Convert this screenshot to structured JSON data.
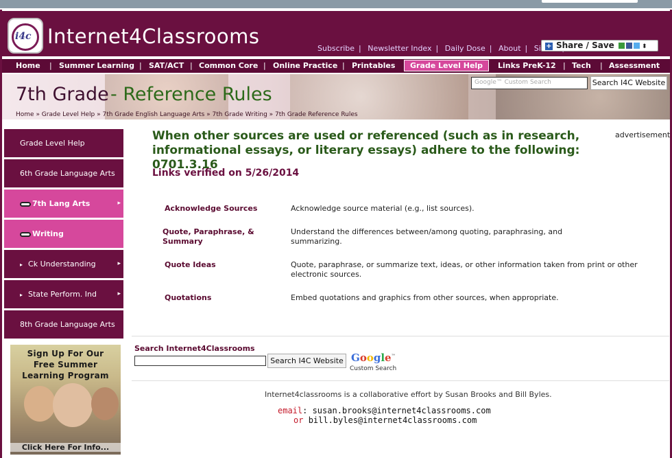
{
  "site": {
    "brand": "Internet4Classrooms",
    "logo_text": "i4c",
    "top_links": [
      "Subscribe",
      "Newsletter Index",
      "Daily Dose",
      "About",
      "Site Map"
    ],
    "share_label": "Share / Save"
  },
  "nav": {
    "items": [
      "Home",
      "Summer Learning",
      "SAT/ACT",
      "Common Core",
      "Online Practice",
      "Printables",
      "Grade Level Help",
      "Links PreK-12",
      "Tech",
      "Assessment"
    ],
    "active": "Grade Level Help"
  },
  "banner": {
    "title_grade": "7th Grade",
    "title_rest": " - Reference Rules",
    "breadcrumb": "Home » Grade Level Help » 7th Grade English Language Arts » 7th Grade Writing » 7th Grade Reference Rules",
    "search_placeholder": "Google™ Custom Search",
    "search_button": "Search I4C Website"
  },
  "sidebar": {
    "items": [
      {
        "label": "Grade Level Help",
        "style": "dark",
        "icon": "none",
        "arrow": ""
      },
      {
        "label": "6th Grade Language Arts",
        "style": "dark",
        "icon": "none",
        "arrow": ""
      },
      {
        "label": "7th Lang Arts",
        "style": "pink",
        "icon": "glasses-icon",
        "arrow": "▸"
      },
      {
        "label": "Writing",
        "style": "pink",
        "icon": "glasses-icon",
        "arrow": ""
      },
      {
        "label": "Ck Understanding",
        "style": "dark",
        "icon": "bullet-icon",
        "arrow": "▸"
      },
      {
        "label": "State Perform. Ind",
        "style": "dark",
        "icon": "bullet-icon",
        "arrow": "▸"
      },
      {
        "label": "8th Grade Language Arts",
        "style": "dark",
        "icon": "none",
        "arrow": ""
      }
    ],
    "promo": {
      "line1": "Sign Up For Our",
      "line2": "Free Summer",
      "line3": "Learning Program",
      "cta": "Click Here For Info..."
    }
  },
  "main": {
    "heading": "When other sources are used or referenced (such as in research, informational essays, or literary essays) adhere to the following: 0701.3.16",
    "advertisement": "advertisement",
    "verified": "Links verified on 5/26/2014",
    "rows": [
      {
        "term": "Acknowledge Sources",
        "desc": "Acknowledge source material (e.g., list sources)."
      },
      {
        "term": "Quote, Paraphrase, &\nSummary",
        "desc": "Understand the differences between/among quoting, paraphrasing, and summarizing."
      },
      {
        "term": "Quote Ideas",
        "desc": "Quote, paraphrase, or summarize text, ideas, or other information taken from print or other electronic sources."
      },
      {
        "term": "Quotations",
        "desc": "Embed quotations and graphics from other sources, when appropriate."
      }
    ]
  },
  "search": {
    "label": "Search Internet4Classrooms",
    "button": "Search I4C Website",
    "google_custom": "Custom Search"
  },
  "footer": {
    "credit": "Internet4classrooms is a collaborative effort by Susan Brooks and Bill Byles.",
    "email_key": "email",
    "email1": "susan.brooks@internet4classrooms.com",
    "or_key": "or",
    "email2": "bill.byles@internet4classrooms.com"
  },
  "colors": {
    "brand": "#6a1040",
    "active": "#d6489c",
    "heading": "#2a5a1a"
  }
}
